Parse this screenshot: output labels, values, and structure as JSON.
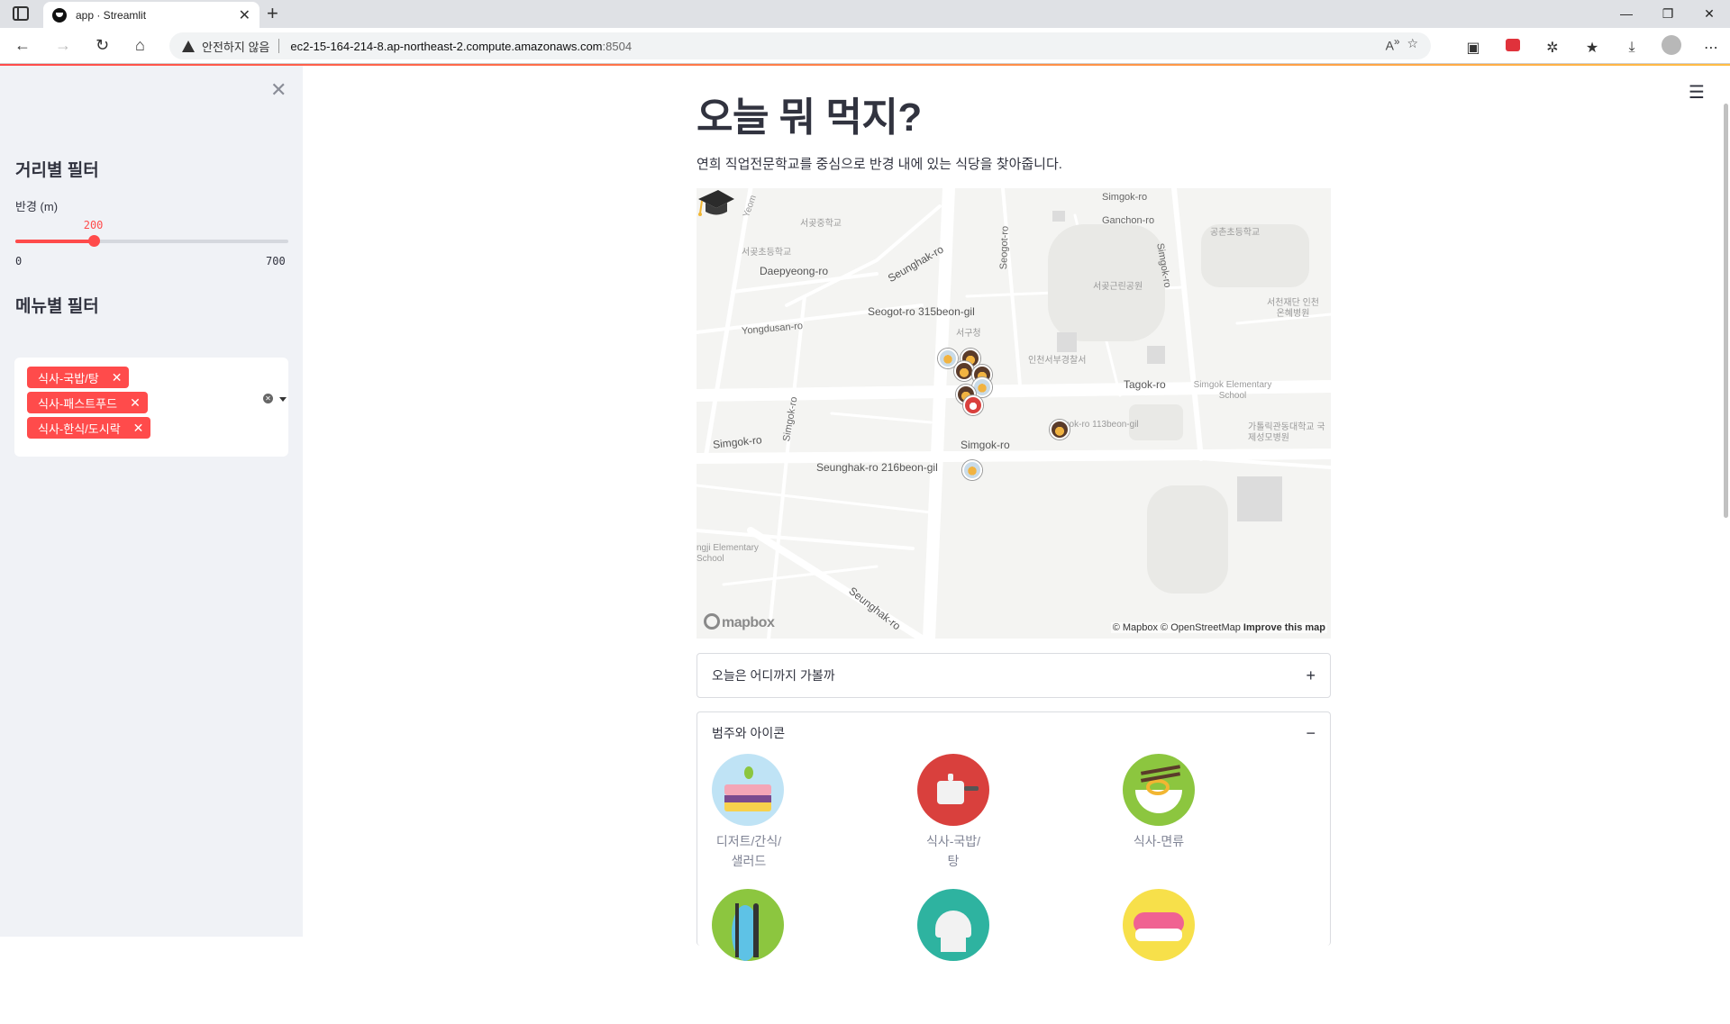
{
  "browser": {
    "tab_title": "app · Streamlit",
    "security_label": "안전하지 않음",
    "url_host": "ec2-15-164-214-8.ap-northeast-2.compute.amazonaws.com",
    "url_port": ":8504"
  },
  "sidebar": {
    "distance_heading": "거리별 필터",
    "radius_label": "반경 (m)",
    "radius_value": 200,
    "radius_value_text": "200",
    "radius_min": "0",
    "radius_max": "700",
    "menu_heading": "메뉴별 필터",
    "selected_menus": [
      "식사-국밥/탕",
      "식사-패스트푸드",
      "식사-한식/도시락"
    ]
  },
  "main": {
    "title": "오늘 뭐 먹지?",
    "description": "연희 직업전문학교를 중심으로 반경 내에 있는 식당을 찾아줍니다.",
    "map": {
      "labels": {
        "simgok_ro_top": "Simgok-ro",
        "ganchon_ro": "Ganchon-ro",
        "simgok_ro_right": "Simgok-ro",
        "seogot_ro": "Seogot-ro",
        "seogong_middle": "서곶중학교",
        "seogong_elem": "서곶초등학교",
        "gongchon_elem": "공촌초등학교",
        "daepyeong_ro": "Daepyeong-ro",
        "seunghak_ro_top": "Seunghak-ro",
        "seogot_ro_315": "Seogot-ro 315beon-gil",
        "seogong_park": "서곶근린공원",
        "seogu_office": "서구청",
        "yongdusan_ro": "Yongdusan-ro",
        "hospital": "서천재단 인천온혜병원",
        "police": "인천서부경찰서",
        "tagok_ro": "Tagok-ro",
        "simgok_elem": "Simgok Elementary School",
        "simgok_ro_left": "Simgok-ro",
        "simgok_ro_vertical": "Simgok-ro",
        "simgok_ro_mid": "Simgok-ro",
        "simgok_ro_113": "gok-ro 113beon-gil",
        "catholic_univ": "가톨릭관동대학교 국제성모병원",
        "seunghak_216": "Seunghak-ro 216beon-gil",
        "gji_elem": "ngji Elementary School",
        "seunghak_ro_bottom": "Seunghak-ro",
        "yeom": "Yeom"
      },
      "logo": "mapbox",
      "attribution": "© Mapbox © OpenStreetMap",
      "improve": "Improve this map"
    },
    "expander_distance": {
      "label": "오늘은 어디까지 가볼까",
      "toggle": "+"
    },
    "expander_icons": {
      "label": "범주와 아이콘",
      "toggle": "−",
      "items": [
        {
          "label": "디저트/간식/샐러드",
          "icon": "cake-icon",
          "color": "#bfe3f5"
        },
        {
          "label": "식사-국밥/탕",
          "icon": "pot-icon",
          "color": "#d9403d"
        },
        {
          "label": "식사-면류",
          "icon": "noodle-icon",
          "color": "#8cc63f"
        },
        {
          "label": "",
          "icon": "cutlery-icon",
          "color": "#8cc63f"
        },
        {
          "label": "",
          "icon": "chef-hat-icon",
          "color": "#2eb3a0"
        },
        {
          "label": "",
          "icon": "sushi-icon",
          "color": "#f7e04a"
        }
      ]
    }
  }
}
